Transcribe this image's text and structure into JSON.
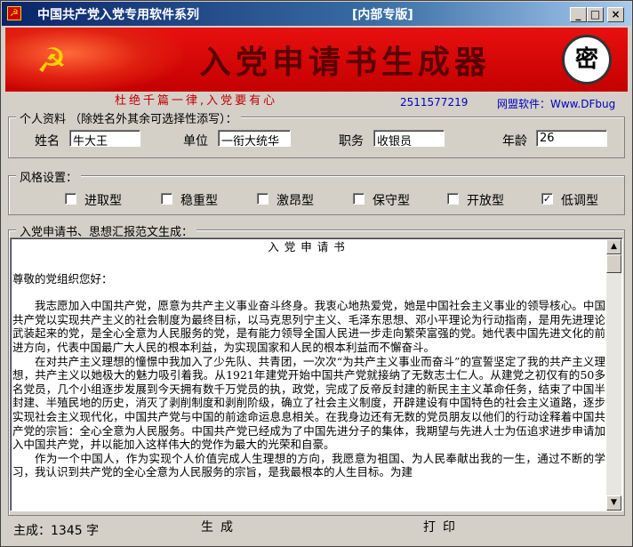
{
  "window": {
    "title": "中国共产党入党专用软件系列",
    "badge": "[内部专版]",
    "icon_glyph": "☭",
    "buttons": {
      "minimize": "_",
      "maximize": "□",
      "close": "×"
    }
  },
  "banner": {
    "emblem_glyph": "☭",
    "title": "入党申请书生成器",
    "secret_label": "密"
  },
  "slogan": "杜绝千篇一律,入党要有心",
  "contact": {
    "qq": "2511577219",
    "website": "网盟软件：Www.DFbug"
  },
  "personal": {
    "group_label": "个人资料 （除姓名外其余可选择性添写）：",
    "name_label": "姓名",
    "name_value": "牛大王",
    "unit_label": "单位",
    "unit_value": "一衔大统华",
    "position_label": "职务",
    "position_value": "收银员",
    "age_label": "年龄",
    "age_value": "26"
  },
  "style": {
    "group_label": "风格设置：",
    "options": [
      {
        "label": "进取型",
        "checked": false
      },
      {
        "label": "稳重型",
        "checked": false
      },
      {
        "label": "激昂型",
        "checked": false
      },
      {
        "label": "保守型",
        "checked": false
      },
      {
        "label": "开放型",
        "checked": false
      },
      {
        "label": "低调型",
        "checked": true
      }
    ]
  },
  "document": {
    "group_label": "入党申请书、思想汇报范文生成：",
    "title": "入党申请书",
    "salutation": "尊敬的党组织您好：",
    "paragraphs": [
      "我志愿加入中国共产党，愿意为共产主义事业奋斗终身。我衷心地热爱党，她是中国社会主义事业的领导核心。中国共产党以实现共产主义的社会制度为最终目标，以马克思列宁主义、毛泽东思想、邓小平理论为行动指南，是用先进理论武装起来的党，是全心全意为人民服务的党，是有能力领导全国人民进一步走向繁荣富强的党。她代表中国先进文化的前进方向，代表中国最广大人民的根本利益，为实现国家和人民的根本利益而不懈奋斗。",
      "在对共产主义理想的憧憬中我加入了少先队、共青团，一次次“为共产主义事业而奋斗”的宣誓坚定了我的共产主义理想，共产主义以她极大的魅力吸引着我。从1921年建党开始中国共产党就接纳了无数志士仁人。从建党之初仅有的50多名党员，几个小组逐步发展到今天拥有数千万党员的执，政党，完成了反帝反封建的新民主主义革命任务，结束了中国半封建、半殖民地的历史，消灭了剥削制度和剥削阶级，确立了社会主义制度，开辟建设有中国特色的社会主义道路，逐步实现社会主义现代化，中国共产党与中国的前途命运息息相关。在我身边还有无数的党员朋友以他们的行动诠释着中国共产党的宗旨：全心全意为人民服务。中国共产党已经成为了中国先进分子的集体，我期望与先进人士为伍追求进步申请加入中国共产党，并以能加入这样伟大的党作为最大的光荣和自豪。",
      "作为一个中国人，作为实现个人价值完成人生理想的方向，我愿意为祖国、为人民奉献出我的一生，通过不断的学习，我认识到共产党的全心全意为人民服务的宗旨，是我最根本的人生目标。为建"
    ]
  },
  "status": {
    "word_count": "主成：1345 字"
  },
  "actions": {
    "generate_label": "生成",
    "print_label": "打印"
  }
}
